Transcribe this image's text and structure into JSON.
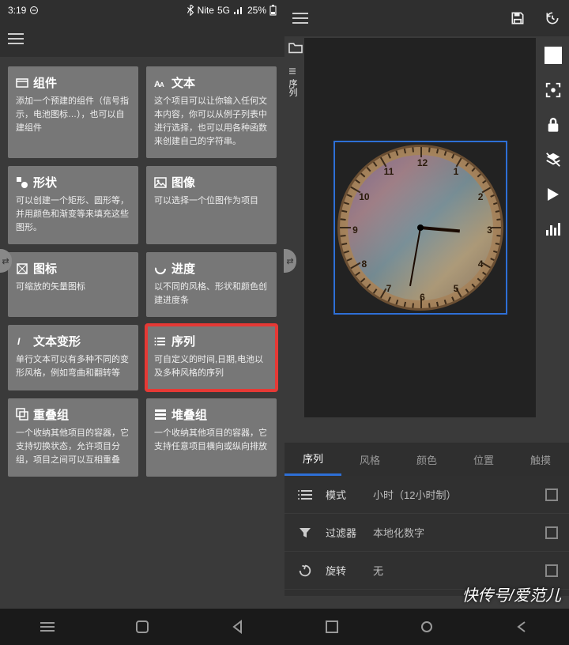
{
  "left": {
    "status": {
      "time": "3:19",
      "dnd": "",
      "bt": "",
      "net": "Nite",
      "signal": "5G",
      "battery": "25%"
    },
    "cards": [
      {
        "icon": "box",
        "title": "组件",
        "desc": "添加一个预建的组件（信号指示，电池图标…），也可以自建组件"
      },
      {
        "icon": "font",
        "title": "文本",
        "desc": "这个项目可以让你输入任何文本内容，你可以从例子列表中进行选择，也可以用各种函数来创建自己的字符串。"
      },
      {
        "icon": "shapes",
        "title": "形状",
        "desc": "可以创建一个矩形、圆形等，并用颜色和渐变等来填充这些图形。"
      },
      {
        "icon": "image",
        "title": "图像",
        "desc": "可以选择一个位图作为项目"
      },
      {
        "icon": "vector",
        "title": "图标",
        "desc": "可缩放的矢量图标"
      },
      {
        "icon": "progress",
        "title": "进度",
        "desc": "以不同的风格、形状和颜色创建进度条"
      },
      {
        "icon": "textmorph",
        "title": "文本变形",
        "desc": "单行文本可以有多种不同的变形风格，例如弯曲和翻转等"
      },
      {
        "icon": "list",
        "title": "序列",
        "desc": "可自定义的时间,日期,电池以及多种风格的序列"
      },
      {
        "icon": "overlap",
        "title": "重叠组",
        "desc": "一个收纳其他项目的容器，它支持切换状态，允许项目分组，项目之间可以互相重叠"
      },
      {
        "icon": "stack",
        "title": "堆叠组",
        "desc": "一个收纳其他项目的容器，它支持任意项目横向或纵向排放"
      }
    ]
  },
  "right": {
    "sideLabel": "序列",
    "tabs": [
      "序列",
      "风格",
      "颜色",
      "位置",
      "触摸"
    ],
    "settings": [
      {
        "icon": "mode",
        "label": "模式",
        "value": "小时（12小时制）"
      },
      {
        "icon": "filter",
        "label": "过滤器",
        "value": "本地化数字"
      },
      {
        "icon": "rotate",
        "label": "旋转",
        "value": "无"
      }
    ],
    "watermark": "快传号/爱范儿",
    "clockNumbers": [
      "12",
      "1",
      "2",
      "3",
      "4",
      "5",
      "6",
      "7",
      "8",
      "9",
      "10",
      "11"
    ]
  }
}
